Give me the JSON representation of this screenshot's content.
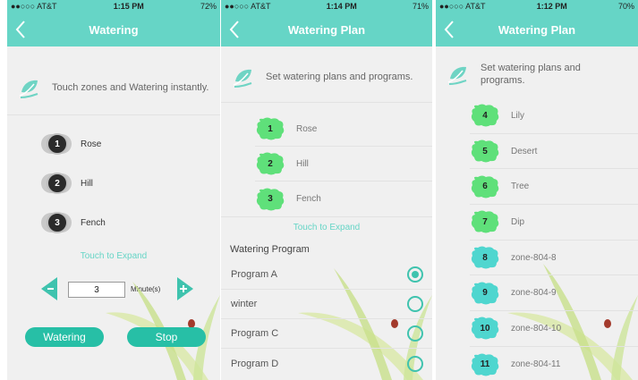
{
  "screen1": {
    "status": {
      "carrier": "●●○○○ AT&T",
      "time": "1:15 PM",
      "battery": "72%"
    },
    "title": "Watering",
    "intro": "Touch zones and Watering instantly.",
    "zones": [
      {
        "num": "1",
        "name": "Rose"
      },
      {
        "num": "2",
        "name": "Hill"
      },
      {
        "num": "3",
        "name": "Fench"
      }
    ],
    "expand": "Touch to Expand",
    "minutes_value": "3",
    "minutes_label": "Minute(s)",
    "watering_button": "Watering",
    "stop_button": "Stop"
  },
  "screen2": {
    "status": {
      "carrier": "●●○○○ AT&T",
      "time": "1:14 PM",
      "battery": "71%"
    },
    "title": "Watering Plan",
    "intro": "Set watering plans and programs.",
    "zones": [
      {
        "num": "1",
        "name": "Rose"
      },
      {
        "num": "2",
        "name": "Hill"
      },
      {
        "num": "3",
        "name": "Fench"
      }
    ],
    "expand": "Touch to Expand",
    "program_heading": "Watering Program",
    "programs": [
      {
        "name": "Program A",
        "selected": true
      },
      {
        "name": "winter",
        "selected": false
      },
      {
        "name": "Program C",
        "selected": false
      },
      {
        "name": "Program D",
        "selected": false
      }
    ]
  },
  "screen3": {
    "status": {
      "carrier": "●●○○○ AT&T",
      "time": "1:12 PM",
      "battery": "70%"
    },
    "title": "Watering Plan",
    "intro": "Set watering plans and programs.",
    "zones": [
      {
        "num": "4",
        "name": "Lily",
        "color": "green"
      },
      {
        "num": "5",
        "name": "Desert",
        "color": "green"
      },
      {
        "num": "6",
        "name": "Tree",
        "color": "green"
      },
      {
        "num": "7",
        "name": "Dip",
        "color": "green"
      },
      {
        "num": "8",
        "name": "zone-804-8",
        "color": "teal"
      },
      {
        "num": "9",
        "name": "zone-804-9",
        "color": "teal"
      },
      {
        "num": "10",
        "name": "zone-804-10",
        "color": "teal"
      },
      {
        "num": "11",
        "name": "zone-804-11",
        "color": "teal"
      }
    ]
  },
  "colors": {
    "header": "#66d5c6",
    "accent": "#27bfa6",
    "badge_green": "#5fe07a",
    "badge_teal": "#4fd6cf"
  }
}
